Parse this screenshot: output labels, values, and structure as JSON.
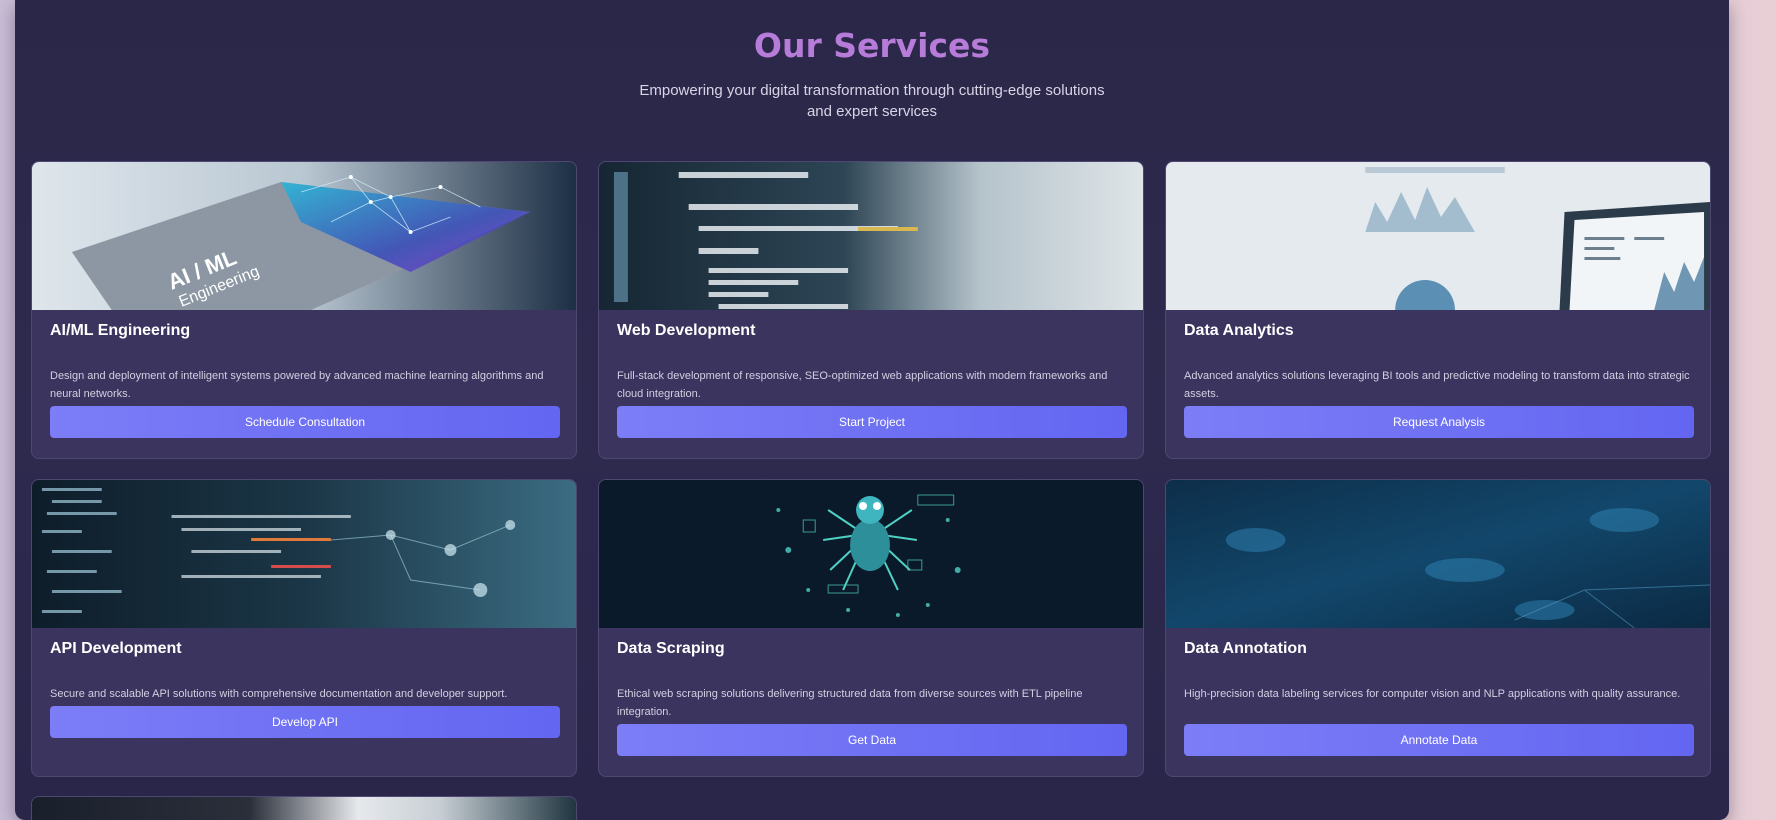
{
  "header": {
    "title": "Our Services",
    "subtitle": "Empowering your digital transformation through cutting-edge solutions and expert services"
  },
  "services": [
    {
      "title": "AI/ML Engineering",
      "description": "Design and deployment of intelligent systems powered by advanced machine learning algorithms and neural networks.",
      "button": "Schedule Consultation",
      "image_text_1": "AI / ML",
      "image_text_2": "Engineering"
    },
    {
      "title": "Web Development",
      "description": "Full-stack development of responsive, SEO-optimized web applications with modern frameworks and cloud integration.",
      "button": "Start Project"
    },
    {
      "title": "Data Analytics",
      "description": "Advanced analytics solutions leveraging BI tools and predictive modeling to transform data into strategic assets.",
      "button": "Request Analysis"
    },
    {
      "title": "API Development",
      "description": "Secure and scalable API solutions with comprehensive documentation and developer support.",
      "button": "Develop API"
    },
    {
      "title": "Data Scraping",
      "description": "Ethical web scraping solutions delivering structured data from diverse sources with ETL pipeline integration.",
      "button": "Get Data"
    },
    {
      "title": "Data Annotation",
      "description": "High-precision data labeling services for computer vision and NLP applications with quality assurance.",
      "button": "Annotate Data"
    }
  ],
  "colors": {
    "accent": "#6366f1",
    "title": "#b77bd9",
    "panel": "#2b2748",
    "card": "#3a345e"
  }
}
